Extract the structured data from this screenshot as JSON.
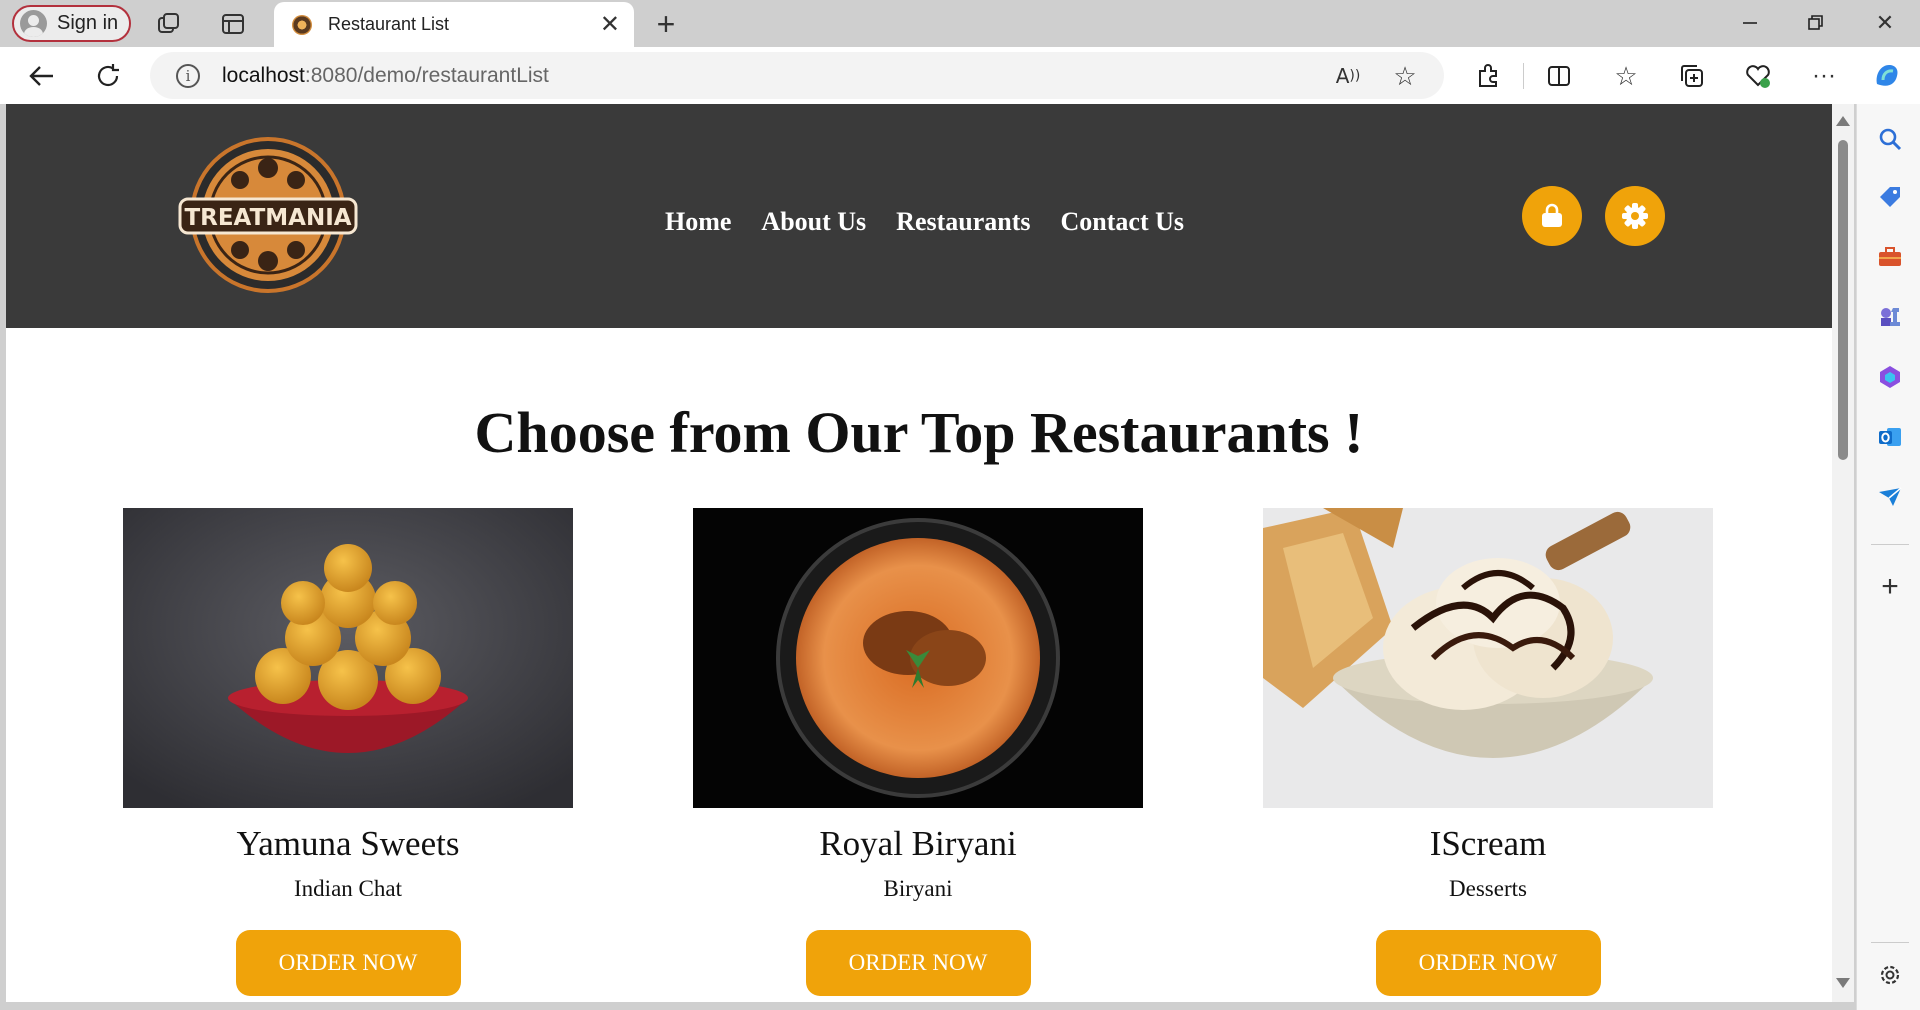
{
  "browser": {
    "profile_label": "Sign in",
    "tab_title": "Restaurant List",
    "url_host": "localhost",
    "url_path": ":8080/demo/restaurantList"
  },
  "site": {
    "logo_text": "TREATMANIA",
    "nav": [
      "Home",
      "About Us",
      "Restaurants",
      "Contact Us"
    ],
    "accent_color": "#f0a30a",
    "header_color": "#3a3a3a"
  },
  "main": {
    "title": "Choose from Our Top Restaurants !",
    "restaurants": [
      {
        "name": "Yamuna Sweets",
        "cuisine": "Indian Chat",
        "button": "ORDER NOW",
        "image_icon": "laddoo-bowl-photo"
      },
      {
        "name": "Royal Biryani",
        "cuisine": "Biryani",
        "button": "ORDER NOW",
        "image_icon": "biryani-bowl-photo"
      },
      {
        "name": "IScream",
        "cuisine": "Desserts",
        "button": "ORDER NOW",
        "image_icon": "ice-cream-bowl-photo"
      }
    ]
  }
}
